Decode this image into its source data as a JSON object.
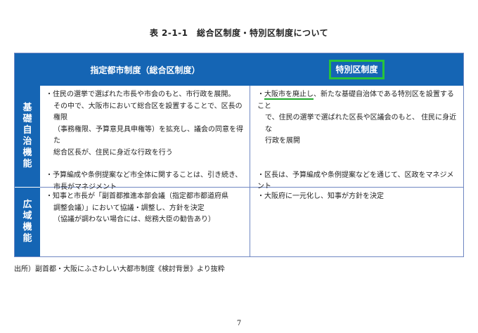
{
  "title": "表 2-1-1　総合区制度・特別区制度について",
  "table": {
    "col_a_header": "指定都市制度（総合区制度）",
    "col_b_header": "特別区制度",
    "row1_label": "基礎自治機能",
    "row2_label": "広域機能",
    "row1_a": {
      "p1_line1": "・住民の選挙で選ばれた市長や市会のもと、市行政を展開。",
      "p1_line2": "その中で、大阪市において総合区を設置することで、区長の権限",
      "p1_line3": "（事務権限、予算意見具申権等）を拡充し、議会の同意を得た",
      "p1_line4": "総合区長が、住民に身近な行政を行う",
      "p2_line1": "・予算編成や条例提案など市全体に関することは、引き続き、",
      "p2_line2": "市長がマネジメント"
    },
    "row1_b": {
      "p1_prefix": "・",
      "p1_underlined": "大阪市を廃止し",
      "p1_rest": "、新たな基礎自治体である特別区を設置すること",
      "p1_line2": "で、住民の選挙で選ばれた区長や区議会のもと、 住民に身近な",
      "p1_line3": "行政を展開",
      "p2_line1": "・区長は、予算編成や条例提案などを通じて、区政をマネジメント"
    },
    "row2_a": {
      "line1": "・知事と市長が「副首都推進本部会議（指定都市都道府県",
      "line2": "調整会議）」において協議・調整し、方針を決定",
      "line3": "（協議が調わない場合には、総務大臣の勧告あり）"
    },
    "row2_b": {
      "line1": "・大阪府に一元化し、知事が方針を決定"
    }
  },
  "source": "出所）副首都・大阪にふさわしい大都市制度《検討背景》より抜粋",
  "page_number": "7",
  "colors": {
    "header_blue": "#1565b4",
    "highlight_green": "#27c43a",
    "border": "#6f87c2"
  }
}
